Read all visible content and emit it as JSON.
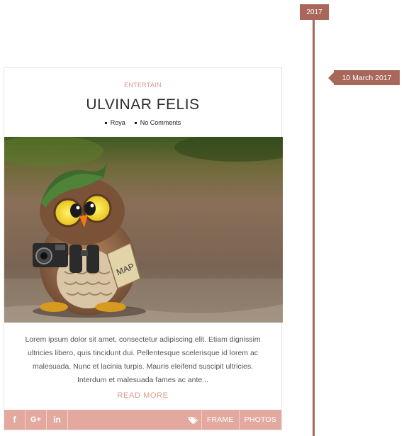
{
  "timeline": {
    "year": "2017",
    "date": "10 March 2017",
    "accent_color": "#a9665b"
  },
  "post": {
    "category": "ENTERTAIN",
    "title": "ULVINAR FELIS",
    "author": "Roya",
    "comments": "No Comments",
    "image_subject": "owl-figurine-with-cap-camera-binoculars-and-map",
    "excerpt": "Lorem ipsum dolor sit amet, consectetur adipiscing elit. Etiam dignissim ultricies libero, quis tincidunt dui. Pellentesque scelerisque id lorem ac malesuada. Nunc et lacinia turpis. Mauris eleifend suscipit ultricies. Interdum et malesuada fames ac ante...",
    "read_more": "READ MORE",
    "footer_color": "#e3a99f"
  },
  "share": {
    "facebook": "f",
    "googleplus": "G+",
    "linkedin": "in"
  },
  "tags": [
    "FRAME",
    "PHOTOS"
  ]
}
